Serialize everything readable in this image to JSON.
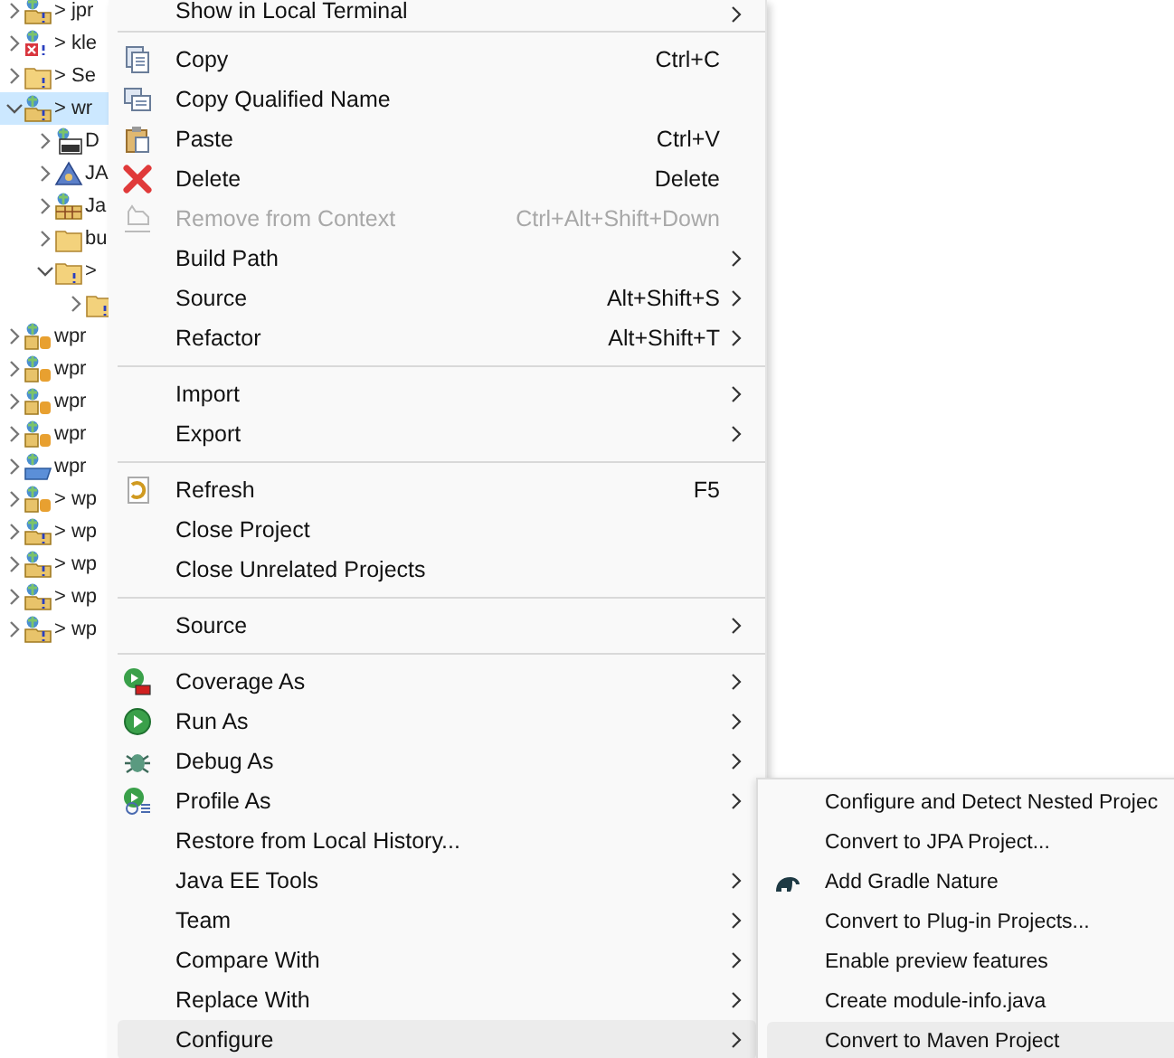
{
  "tree": [
    {
      "label": "> jpr",
      "kind": "project",
      "expanded": false,
      "selected": false
    },
    {
      "label": "> kle",
      "kind": "project-error",
      "expanded": false,
      "selected": false
    },
    {
      "label": "> Se",
      "kind": "folder-project",
      "expanded": false,
      "selected": false
    },
    {
      "label": "> wr",
      "kind": "project",
      "expanded": true,
      "selected": true,
      "children": [
        {
          "label": "D",
          "kind": "descriptor",
          "expanded": false,
          "selected": false
        },
        {
          "label": "JA",
          "kind": "jax",
          "expanded": false,
          "selected": false
        },
        {
          "label": "Ja",
          "kind": "resources",
          "expanded": false,
          "selected": false
        },
        {
          "label": "bu",
          "kind": "folder",
          "expanded": false,
          "selected": false
        },
        {
          "label": ">",
          "kind": "folder-unknown",
          "expanded": true,
          "selected": false,
          "children": [
            {
              "kind": "folder-unknown",
              "expanded": false,
              "selected": false
            }
          ]
        }
      ]
    },
    {
      "label": "wpr",
      "kind": "project-db",
      "expanded": false,
      "selected": false
    },
    {
      "label": "wpr",
      "kind": "project-db",
      "expanded": false,
      "selected": false
    },
    {
      "label": "wpr",
      "kind": "project-db",
      "expanded": false,
      "selected": false
    },
    {
      "label": "wpr",
      "kind": "project-db",
      "expanded": false,
      "selected": false
    },
    {
      "label": "wpr",
      "kind": "project-open",
      "expanded": false,
      "selected": false
    },
    {
      "label": "> wp",
      "kind": "project-db",
      "expanded": false,
      "selected": false
    },
    {
      "label": "> wp",
      "kind": "project",
      "expanded": false,
      "selected": false
    },
    {
      "label": "> wp",
      "kind": "project",
      "expanded": false,
      "selected": false
    },
    {
      "label": "> wp",
      "kind": "project",
      "expanded": false,
      "selected": false
    },
    {
      "label": "> wp",
      "kind": "project",
      "expanded": false,
      "selected": false
    }
  ],
  "menu": {
    "items": [
      {
        "kind": "item",
        "label": "Show in Local Terminal",
        "submenu": true,
        "disabled": false,
        "selected": false
      },
      {
        "kind": "separator"
      },
      {
        "kind": "item",
        "label": "Copy",
        "shortcut": "Ctrl+C",
        "submenu": false,
        "disabled": false,
        "selected": false
      },
      {
        "kind": "item",
        "label": "Copy Qualified Name",
        "submenu": false,
        "disabled": false,
        "selected": false
      },
      {
        "kind": "item",
        "label": "Paste",
        "shortcut": "Ctrl+V",
        "submenu": false,
        "disabled": false,
        "selected": false
      },
      {
        "kind": "item",
        "label": "Delete",
        "shortcut": "Delete",
        "submenu": false,
        "disabled": false,
        "selected": false
      },
      {
        "kind": "item",
        "label": "Remove from Context",
        "shortcut": "Ctrl+Alt+Shift+Down",
        "submenu": false,
        "disabled": true,
        "selected": false
      },
      {
        "kind": "item",
        "label": "Build Path",
        "submenu": true,
        "disabled": false,
        "selected": false
      },
      {
        "kind": "item",
        "label": "Source",
        "shortcut": "Alt+Shift+S",
        "submenu": true,
        "disabled": false,
        "selected": false
      },
      {
        "kind": "item",
        "label": "Refactor",
        "shortcut": "Alt+Shift+T",
        "submenu": true,
        "disabled": false,
        "selected": false
      },
      {
        "kind": "separator"
      },
      {
        "kind": "item",
        "label": "Import",
        "submenu": true,
        "disabled": false,
        "selected": false
      },
      {
        "kind": "item",
        "label": "Export",
        "submenu": true,
        "disabled": false,
        "selected": false
      },
      {
        "kind": "separator"
      },
      {
        "kind": "item",
        "label": "Refresh",
        "shortcut": "F5",
        "submenu": false,
        "disabled": false,
        "selected": false
      },
      {
        "kind": "item",
        "label": "Close Project",
        "submenu": false,
        "disabled": false,
        "selected": false
      },
      {
        "kind": "item",
        "label": "Close Unrelated Projects",
        "submenu": false,
        "disabled": false,
        "selected": false
      },
      {
        "kind": "separator"
      },
      {
        "kind": "item",
        "label": "Source",
        "submenu": true,
        "disabled": false,
        "selected": false
      },
      {
        "kind": "separator"
      },
      {
        "kind": "item",
        "label": "Coverage As",
        "submenu": true,
        "disabled": false,
        "selected": false
      },
      {
        "kind": "item",
        "label": "Run As",
        "submenu": true,
        "disabled": false,
        "selected": false
      },
      {
        "kind": "item",
        "label": "Debug As",
        "submenu": true,
        "disabled": false,
        "selected": false
      },
      {
        "kind": "item",
        "label": "Profile As",
        "submenu": true,
        "disabled": false,
        "selected": false
      },
      {
        "kind": "item",
        "label": "Restore from Local History...",
        "submenu": false,
        "disabled": false,
        "selected": false
      },
      {
        "kind": "item",
        "label": "Java EE Tools",
        "submenu": true,
        "disabled": false,
        "selected": false
      },
      {
        "kind": "item",
        "label": "Team",
        "submenu": true,
        "disabled": false,
        "selected": false
      },
      {
        "kind": "item",
        "label": "Compare With",
        "submenu": true,
        "disabled": false,
        "selected": false
      },
      {
        "kind": "item",
        "label": "Replace With",
        "submenu": true,
        "disabled": false,
        "selected": false
      },
      {
        "kind": "item",
        "label": "Configure",
        "submenu": true,
        "disabled": false,
        "selected": true
      }
    ]
  },
  "submenu": {
    "items": [
      {
        "label": "Configure and Detect Nested Projec",
        "selected": false
      },
      {
        "label": "Convert to JPA Project...",
        "selected": false
      },
      {
        "label": "Add Gradle Nature",
        "selected": false
      },
      {
        "label": "Convert to Plug-in Projects...",
        "selected": false
      },
      {
        "label": "Enable preview features",
        "selected": false
      },
      {
        "label": "Create module-info.java",
        "selected": false
      },
      {
        "label": "Convert to Maven Project",
        "selected": true
      }
    ]
  }
}
